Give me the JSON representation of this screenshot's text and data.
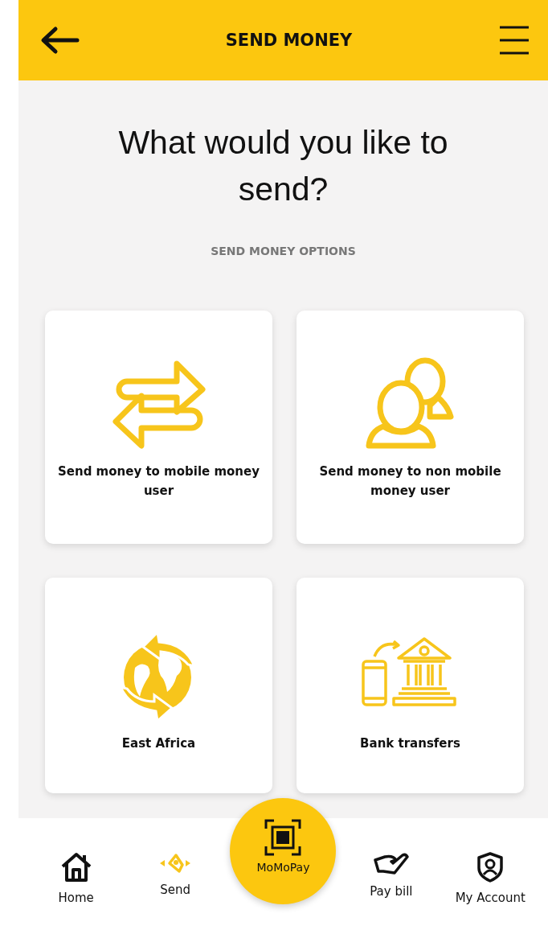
{
  "header": {
    "title": "SEND MONEY"
  },
  "heading": "What would you like to send?",
  "subheading": "SEND MONEY OPTIONS",
  "options": [
    {
      "kind": "swap",
      "label": "Send money to mobile money user"
    },
    {
      "kind": "people",
      "label": "Send money to non mobile money user"
    },
    {
      "kind": "globe",
      "label": "East Africa"
    },
    {
      "kind": "bank",
      "label": "Bank transfers"
    }
  ],
  "nav": [
    {
      "kind": "home",
      "label": "Home",
      "selected": false
    },
    {
      "kind": "send",
      "label": "Send",
      "selected": true
    },
    {
      "kind": "scan",
      "label": "MoMoPay",
      "selected": false
    },
    {
      "kind": "bill",
      "label": "Pay bill",
      "selected": false
    },
    {
      "kind": "account",
      "label": "My Account",
      "selected": false
    }
  ]
}
